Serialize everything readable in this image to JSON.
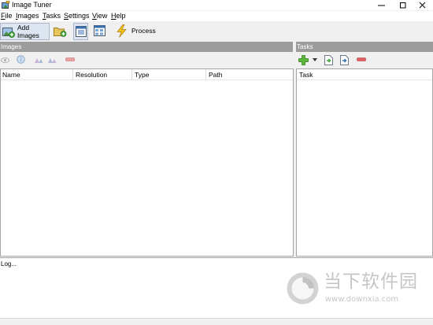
{
  "window": {
    "title": "Image Tuner",
    "controls": [
      "minimize",
      "maximize",
      "close"
    ]
  },
  "menu": [
    {
      "label": "File"
    },
    {
      "label": "Images"
    },
    {
      "label": "Tasks"
    },
    {
      "label": "Settings"
    },
    {
      "label": "View"
    },
    {
      "label": "Help"
    }
  ],
  "toolbar": {
    "add_images_line1": "Add",
    "add_images_line2": "Images",
    "process_label": "Process"
  },
  "images_panel": {
    "header": "Images",
    "columns": [
      "Name",
      "Resolution",
      "Type",
      "Path"
    ],
    "rows": []
  },
  "tasks_panel": {
    "header": "Tasks",
    "columns": [
      "Task"
    ],
    "rows": []
  },
  "log": {
    "label": "Log..."
  },
  "watermark": {
    "brand_cn": "当下软件园",
    "url": "www.downxia.com"
  },
  "colors": {
    "panel_header": "#9c9c9c",
    "accent_green": "#3fa535",
    "process_yellow": "#f2c21b",
    "remove_red": "#e06060"
  }
}
